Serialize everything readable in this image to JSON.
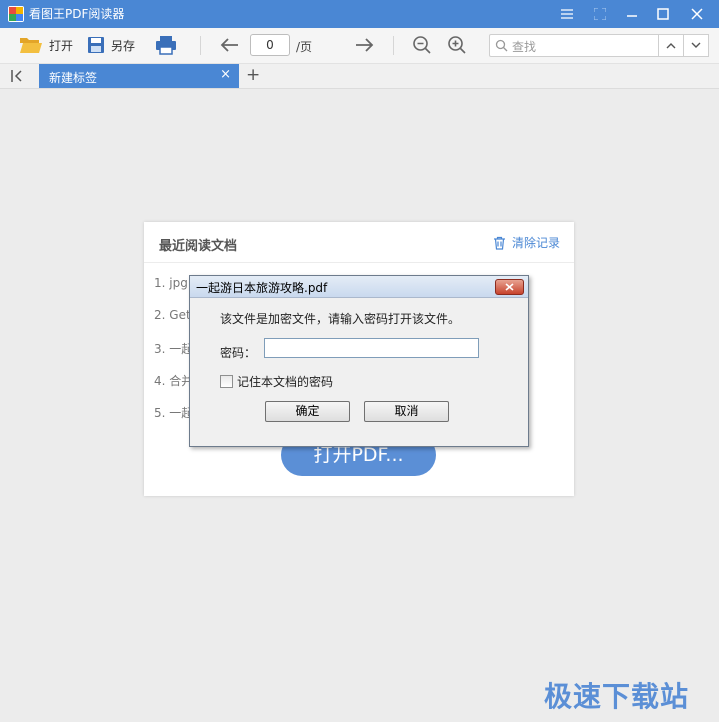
{
  "app": {
    "title": "看图王PDF阅读器",
    "logo_text": "PDF"
  },
  "window_controls": [
    "menu-icon",
    "fullscreen-icon",
    "minimize-icon",
    "maximize-icon",
    "close-icon"
  ],
  "toolbar": {
    "open_label": "打开",
    "save_as_label": "另存",
    "page_value": "0",
    "page_suffix": "/页",
    "search_placeholder": "查找"
  },
  "tabs": [
    {
      "label": "新建标签",
      "close": "×"
    }
  ],
  "tab_add": "+",
  "recent": {
    "title": "最近阅读文档",
    "clear_label": "清除记录",
    "items": [
      "1. jpg",
      "2. Get",
      "3. 一起",
      "4. 合并",
      "5. 一起"
    ],
    "open_button": "打开PDF..."
  },
  "dialog": {
    "title": "一起游日本旅游攻略.pdf",
    "message": "该文件是加密文件，请输入密码打开该文件。",
    "password_label": "密码：",
    "password_value": "",
    "remember_label": "记住本文档的密码",
    "remember_checked": false,
    "ok_label": "确定",
    "cancel_label": "取消"
  },
  "watermark": "极速下载站",
  "colors": {
    "accent": "#4a87d4",
    "button_blue": "#5b8fd6",
    "background": "#ececec"
  }
}
